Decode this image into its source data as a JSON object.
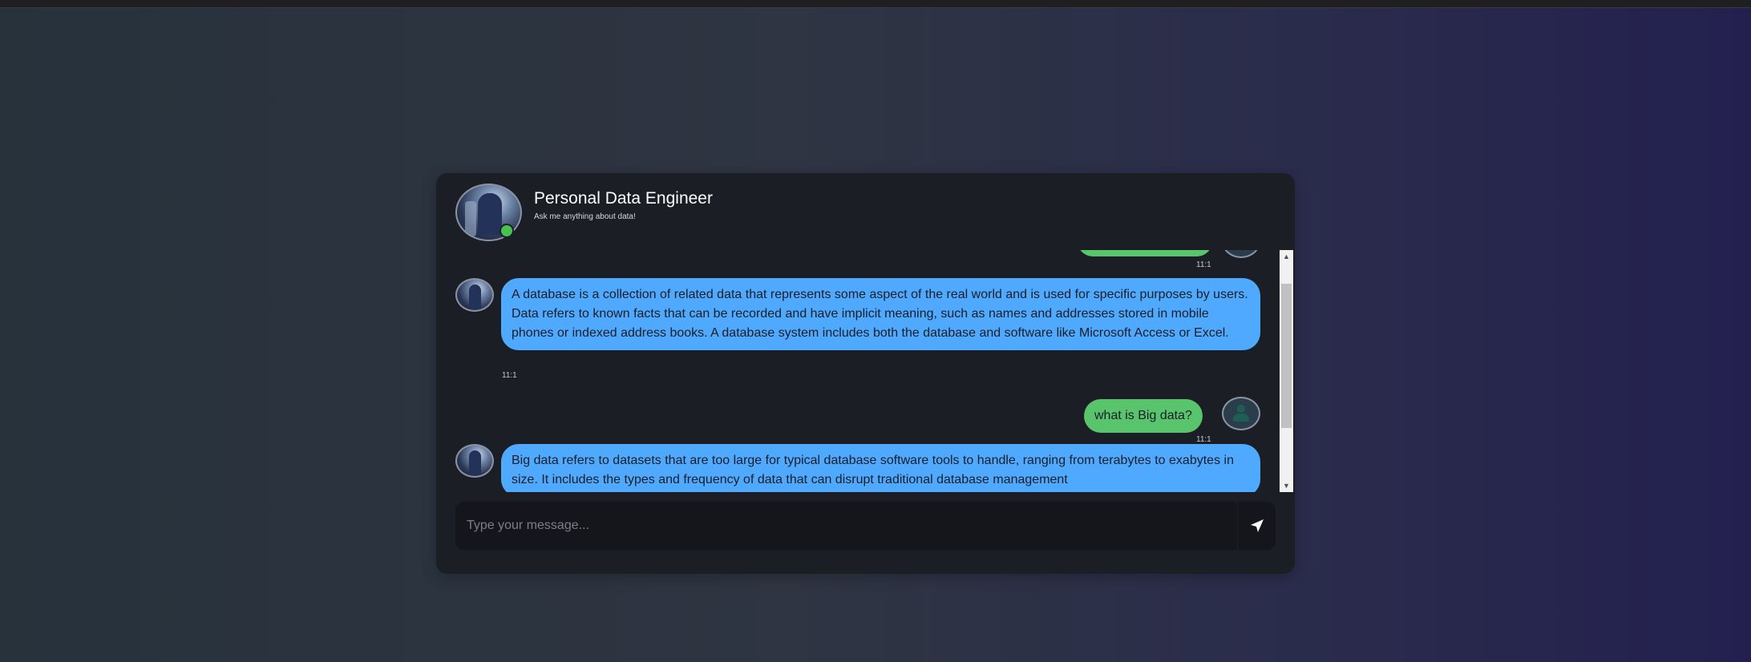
{
  "header": {
    "title": "Personal Data Engineer",
    "subtitle": "Ask me anything about data!"
  },
  "messages": [
    {
      "sender": "user",
      "text": "",
      "time": "11:1"
    },
    {
      "sender": "bot",
      "text": "A database is a collection of related data that represents some aspect of the real world and is used for specific purposes by users. Data refers to known facts that can be recorded and have implicit meaning, such as names and addresses stored in mobile phones or indexed address books. A database system includes both the database and software like Microsoft Access or Excel.",
      "time": "11:1"
    },
    {
      "sender": "user",
      "text": "what is Big data?",
      "time": "11:1"
    },
    {
      "sender": "bot",
      "text": "Big data refers to datasets that are too large for typical database software tools to handle, ranging from terabytes to exabytes in size. It includes the types and frequency of data that can disrupt traditional database management",
      "time": ""
    }
  ],
  "input": {
    "placeholder": "Type your message..."
  },
  "icons": {
    "send": "send-icon",
    "status": "online-status-dot"
  },
  "colors": {
    "bot_bubble": "#4ea9ff",
    "user_bubble": "#58c46c",
    "panel": "#1c1e26",
    "online": "#47c24f"
  }
}
